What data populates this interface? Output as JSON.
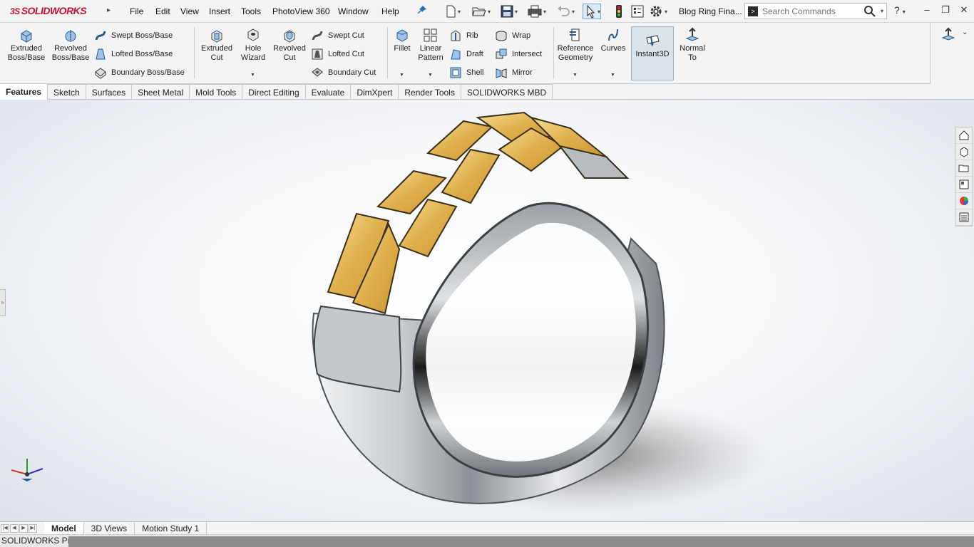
{
  "app": {
    "logo_text": "SOLIDWORKS",
    "menus": [
      "File",
      "Edit",
      "View",
      "Insert",
      "Tools",
      "PhotoView 360",
      "Window",
      "Help"
    ],
    "document_title": "Blog Ring Fina...",
    "search_placeholder": "Search Commands",
    "help_label": "?"
  },
  "ribbon": {
    "extrude_boss": "Extruded Boss/Base",
    "revolve_boss": "Revolved Boss/Base",
    "swept_boss": "Swept Boss/Base",
    "lofted_boss": "Lofted Boss/Base",
    "boundary_boss": "Boundary Boss/Base",
    "extrude_cut": "Extruded Cut",
    "hole_wizard": "Hole Wizard",
    "revolve_cut": "Revolved Cut",
    "swept_cut": "Swept Cut",
    "lofted_cut": "Lofted Cut",
    "boundary_cut": "Boundary Cut",
    "fillet": "Fillet",
    "linear_pattern": "Linear Pattern",
    "rib": "Rib",
    "draft": "Draft",
    "shell": "Shell",
    "wrap": "Wrap",
    "intersect": "Intersect",
    "mirror": "Mirror",
    "reference_geometry": "Reference Geometry",
    "curves": "Curves",
    "instant3d": "Instant3D",
    "normal_to": "Normal To"
  },
  "tabs": [
    "Features",
    "Sketch",
    "Surfaces",
    "Sheet Metal",
    "Mold Tools",
    "Direct Editing",
    "Evaluate",
    "DimXpert",
    "Render Tools",
    "SOLIDWORKS MBD"
  ],
  "active_tab": "Features",
  "bottom_tabs": [
    "Model",
    "3D Views",
    "Motion Study 1"
  ],
  "active_bottom_tab": "Model",
  "status": {
    "text": "SOLIDWORKS Pr"
  },
  "colors": {
    "gold": "#e7b94e",
    "silver": "#b9bec4",
    "accent": "#c8102e"
  }
}
